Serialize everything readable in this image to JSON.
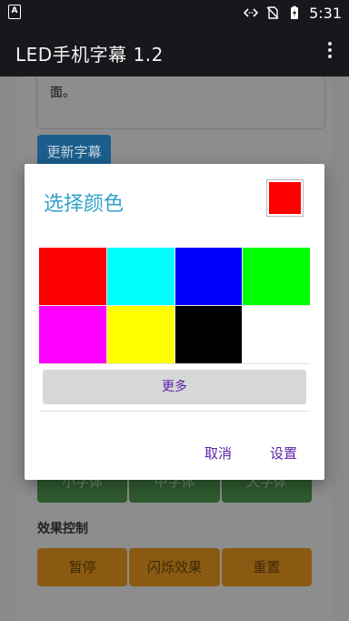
{
  "status_bar": {
    "left_icon": "A",
    "icons": [
      "code-brackets-icon",
      "no-sim-icon",
      "battery-charging-icon"
    ],
    "time": "5:31"
  },
  "app_bar": {
    "title": "LED手机字幕 1.2",
    "overflow_icon": "more-vert-icon"
  },
  "background": {
    "text_area_content": "面。",
    "update_button": "更新字幕",
    "font_buttons": [
      "小字体",
      "中字体",
      "大字体"
    ],
    "effect_section_label": "效果控制",
    "effect_buttons": [
      "暂停",
      "闪烁效果",
      "重置"
    ]
  },
  "dialog": {
    "title": "选择颜色",
    "selected_color": "#ff0000",
    "palette": [
      "#ff0000",
      "#00ffff",
      "#0000ff",
      "#00ff00",
      "#ff00ff",
      "#ffff00",
      "#000000",
      "#ffffff"
    ],
    "more_button": "更多",
    "cancel_button": "取消",
    "confirm_button": "设置"
  },
  "colors": {
    "title_accent": "#33a3c9",
    "action_text": "#5b1fa8"
  }
}
